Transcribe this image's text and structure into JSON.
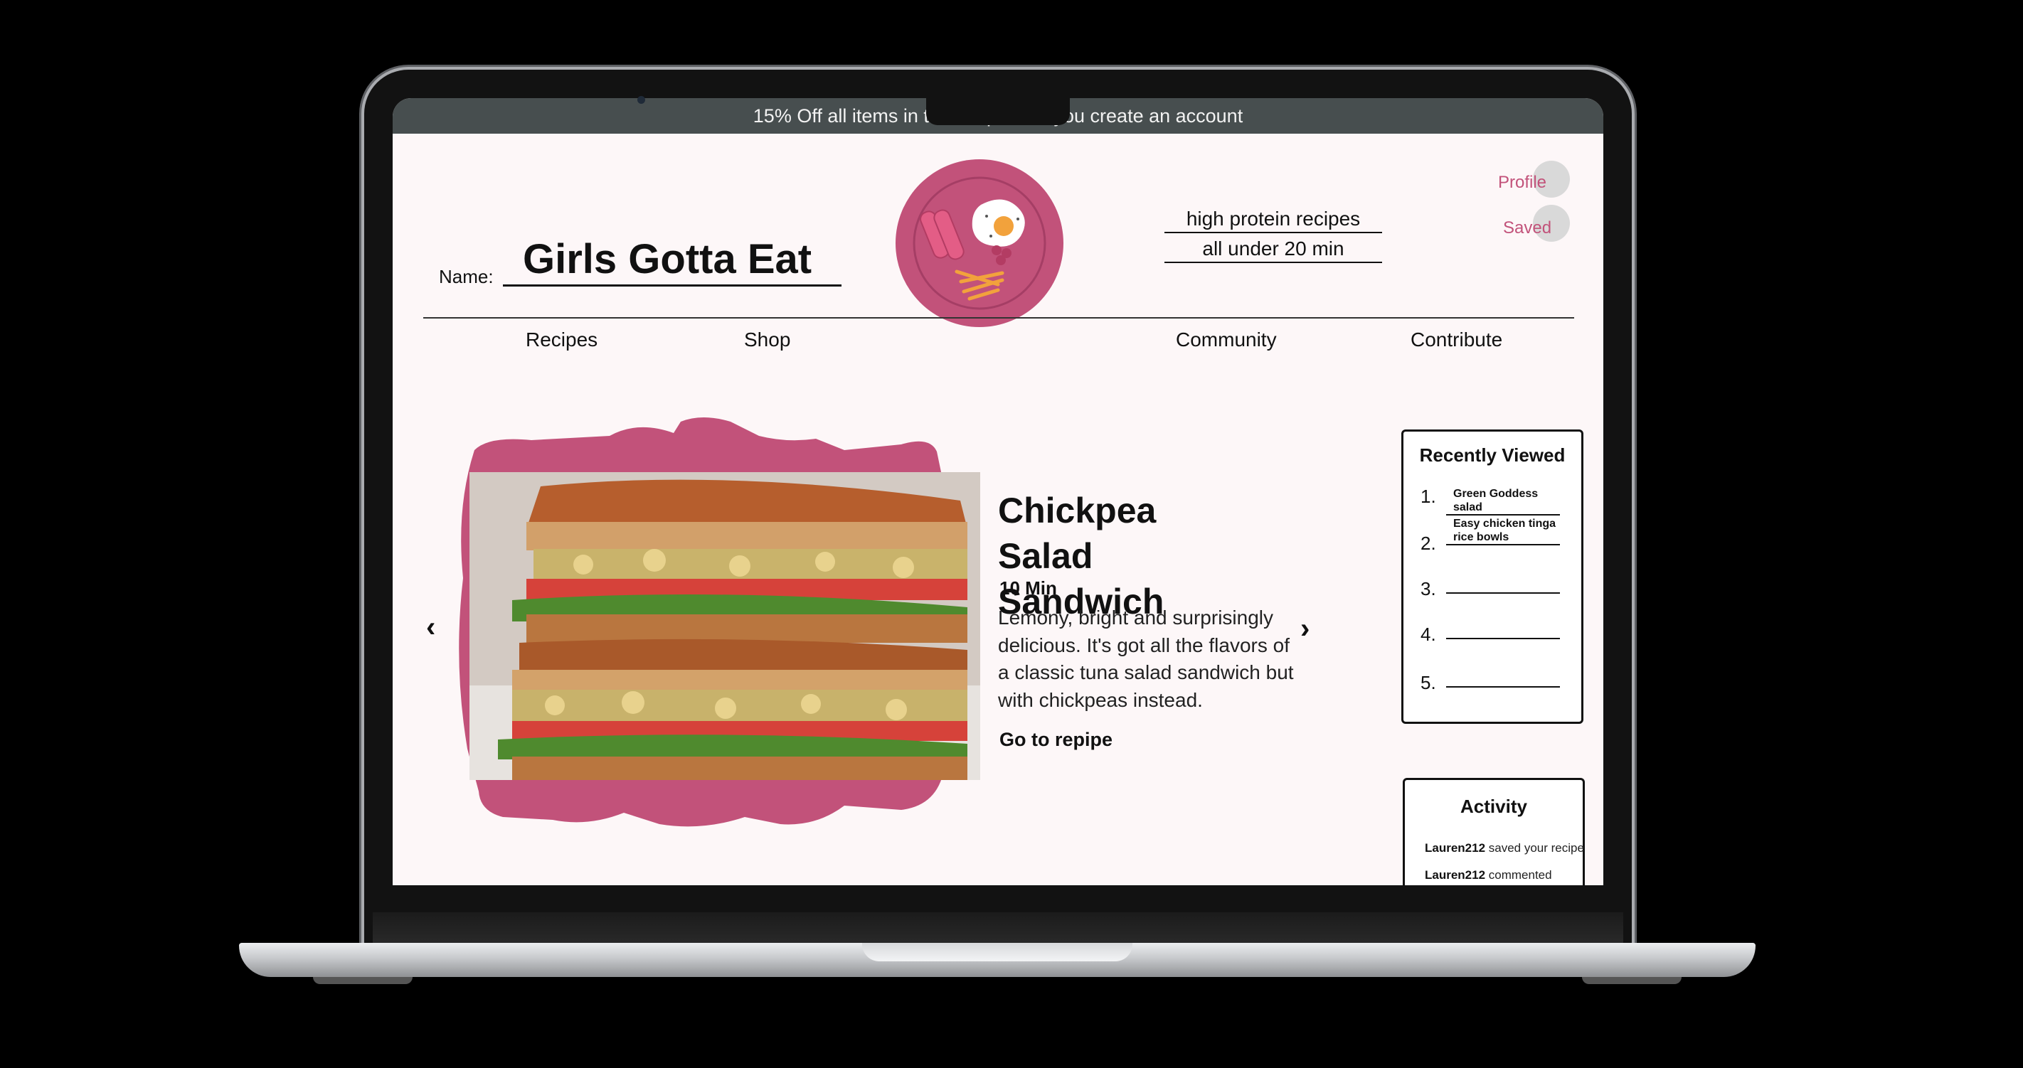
{
  "promo": {
    "text": "15% Off all items in the shop when you create an account"
  },
  "brand": {
    "label": "Name:",
    "name": "Girls Gotta Eat"
  },
  "taglines": [
    "high protein recipes",
    "all under 20 min"
  ],
  "user_links": {
    "profile": "Profile",
    "saved": "Saved"
  },
  "nav": [
    "Recipes",
    "Shop",
    "Community",
    "Contribute"
  ],
  "hero": {
    "title": "Chickpea Salad Sandwich",
    "time": "10 Min",
    "description": "Lemony, bright and surprisingly delicious. It's got all the flavors of a classic tuna salad sandwich but with chickpeas instead.",
    "link": "Go to repipe",
    "image_icon": "sandwich-photo",
    "prev_icon": "chevron-left-icon",
    "next_icon": "chevron-right-icon"
  },
  "recently_viewed": {
    "title": "Recently Viewed",
    "items": [
      {
        "num": "1.",
        "label": "Green Goddess salad"
      },
      {
        "num": "2.",
        "label": "Easy chicken tinga rice bowls"
      },
      {
        "num": "3.",
        "label": ""
      },
      {
        "num": "4.",
        "label": ""
      },
      {
        "num": "5.",
        "label": ""
      }
    ]
  },
  "activity": {
    "title": "Activity",
    "items": [
      {
        "user": "Lauren212",
        "action": " saved your recipe"
      },
      {
        "user": "Lauren212",
        "action": " commented"
      }
    ]
  },
  "colors": {
    "accent": "#c2527a",
    "promo_bar": "#474e4f",
    "page_bg": "#fdf7f8",
    "logo_plate": "#c2527a",
    "logo_yolk": "#f2a23c"
  }
}
